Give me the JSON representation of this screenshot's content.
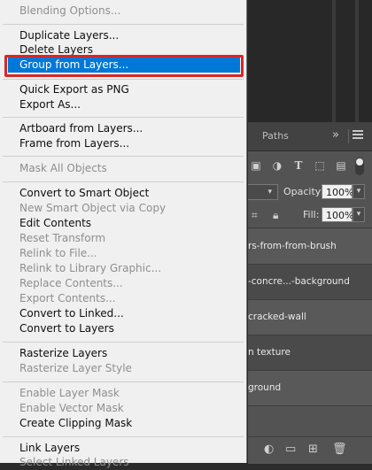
{
  "menu": {
    "items": [
      {
        "label": "Blending Options...",
        "enabled": false
      },
      {
        "label": "Duplicate Layers...",
        "enabled": true
      },
      {
        "label": "Delete Layers",
        "enabled": true
      },
      {
        "label": "Group from Layers...",
        "enabled": true,
        "highlighted": true
      },
      {
        "label": "Quick Export as PNG",
        "enabled": true
      },
      {
        "label": "Export As...",
        "enabled": true
      },
      {
        "label": "Artboard from Layers...",
        "enabled": true
      },
      {
        "label": "Frame from Layers...",
        "enabled": true
      },
      {
        "label": "Mask All Objects",
        "enabled": false
      },
      {
        "label": "Convert to Smart Object",
        "enabled": true
      },
      {
        "label": "New Smart Object via Copy",
        "enabled": false
      },
      {
        "label": "Edit Contents",
        "enabled": true
      },
      {
        "label": "Reset Transform",
        "enabled": false
      },
      {
        "label": "Relink to File...",
        "enabled": false
      },
      {
        "label": "Relink to Library Graphic...",
        "enabled": false
      },
      {
        "label": "Replace Contents...",
        "enabled": false
      },
      {
        "label": "Export Contents...",
        "enabled": false
      },
      {
        "label": "Convert to Linked...",
        "enabled": true
      },
      {
        "label": "Convert to Layers",
        "enabled": true
      },
      {
        "label": "Rasterize Layers",
        "enabled": true
      },
      {
        "label": "Rasterize Layer Style",
        "enabled": false
      },
      {
        "label": "Enable Layer Mask",
        "enabled": false
      },
      {
        "label": "Enable Vector Mask",
        "enabled": false
      },
      {
        "label": "Create Clipping Mask",
        "enabled": true
      },
      {
        "label": "Link Layers",
        "enabled": true
      },
      {
        "label": "Select Linked Layers",
        "enabled": false
      }
    ]
  },
  "layers_panel": {
    "tab_paths": "Paths",
    "tab_collapse": "»",
    "opacity_label": "Opacity:",
    "opacity_value": "100%",
    "fill_label": "Fill:",
    "fill_value": "100%",
    "layers": [
      "rs-from-from-brush",
      "-concre...-background",
      "cracked-wall",
      "n texture",
      "ground"
    ]
  },
  "colors": {
    "highlight": "#0078d7",
    "annotation": "#d62828",
    "menu_bg": "#f0f0f0",
    "panel_bg": "#535353"
  }
}
